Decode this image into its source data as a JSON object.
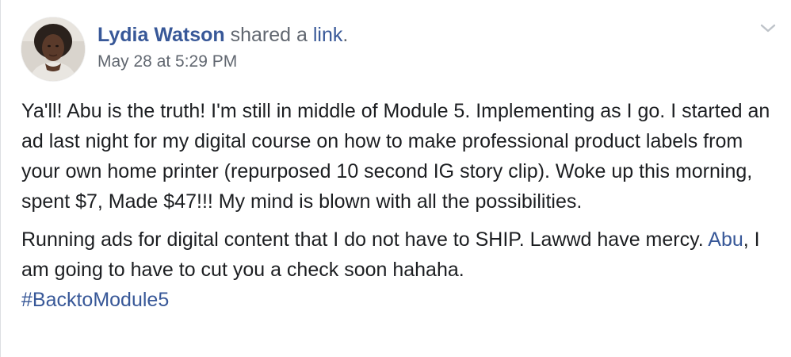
{
  "post": {
    "author": "Lydia Watson",
    "action_text": " shared a ",
    "action_link": "link",
    "action_end": ".",
    "timestamp": "May 28 at 5:29 PM",
    "paragraph1": "Ya'll! Abu is the truth! I'm still in middle of Module 5. Implementing as I go. I started an ad last night for my digital course on how to make professional product labels from your own home printer (repurposed 10 second IG story clip). Woke up this morning, spent $7, Made $47!!! My mind is blown with all the possibilities.",
    "paragraph2_start": "Running ads for digital content that I do not have to SHIP. Lawwd have mercy. ",
    "paragraph2_mention": "Abu",
    "paragraph2_end": ", I am going to have to cut you a check soon hahaha.",
    "hashtag": "#BacktoModule5"
  },
  "icons": {
    "menu": "chevron-down-icon",
    "avatar": "profile-photo"
  },
  "colors": {
    "link": "#385898",
    "meta": "#616770",
    "text": "#1c1e21",
    "chevron": "#bec3c9"
  }
}
